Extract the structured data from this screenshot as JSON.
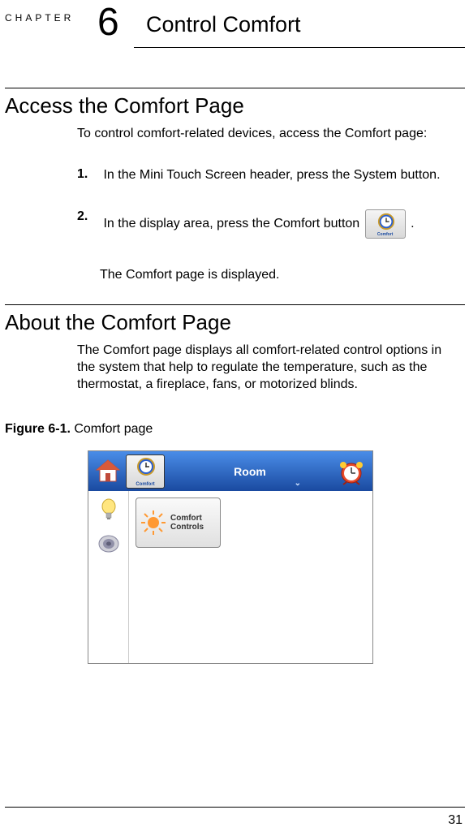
{
  "chapter": {
    "label": "CHAPTER",
    "number": "6",
    "title": "Control Comfort"
  },
  "section1": {
    "title": "Access the Comfort Page",
    "intro": "To control comfort-related devices, access the Comfort page:",
    "step1_num": "1.",
    "step1_text": "In the Mini Touch Screen header, press the System button.",
    "step2_num": "2.",
    "step2_text_a": "In the display area, press the Comfort button",
    "step2_text_b": ".",
    "step2_result": "The Comfort page is displayed.",
    "comfort_btn_label": "Comfort"
  },
  "section2": {
    "title": "About the Comfort Page",
    "body": "The Comfort page displays all comfort-related control options in the system that help to regulate the temperature, such as the thermostat, a fireplace, fans, or motorized blinds."
  },
  "figure": {
    "label_bold": "Figure 6-1.",
    "label_text": " Comfort page",
    "titlebar_room": "Room",
    "titlebar_comfort_label": "Comfort",
    "main_btn_line1": "Comfort",
    "main_btn_line2": "Controls"
  },
  "page_number": "31"
}
